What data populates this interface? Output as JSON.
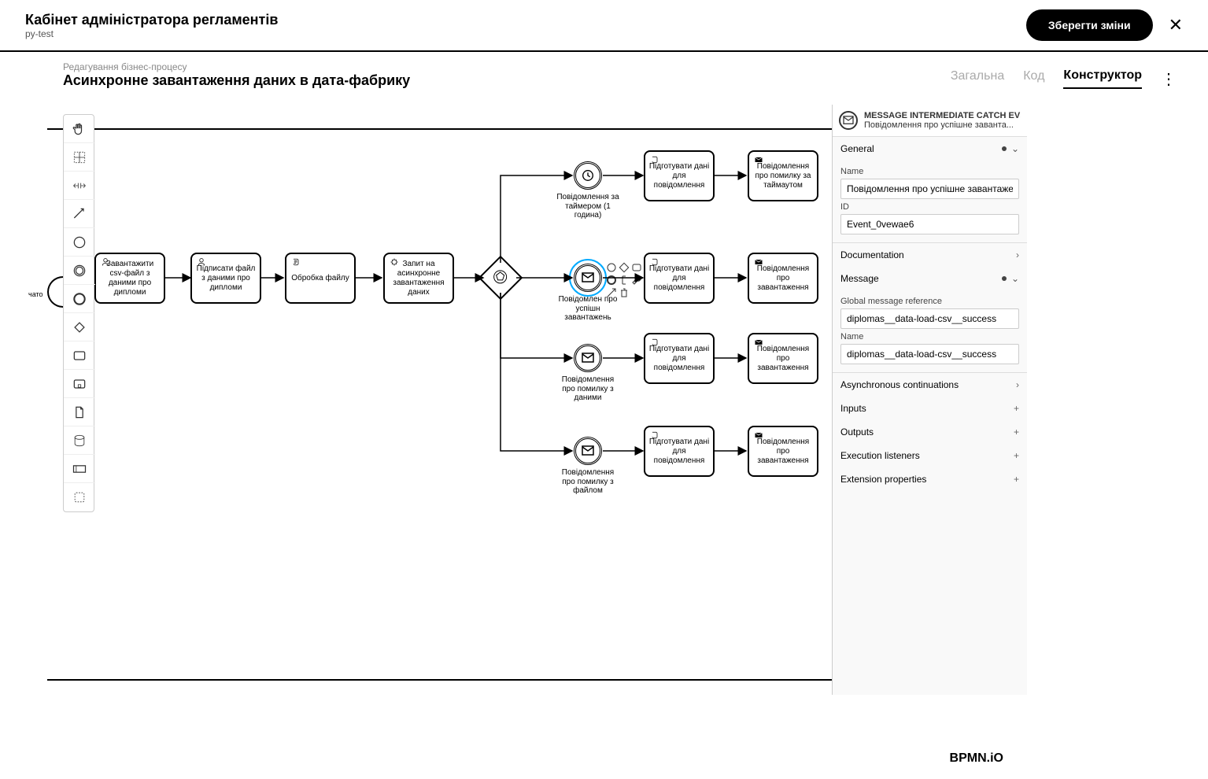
{
  "header": {
    "title": "Кабінет адміністратора регламентів",
    "subtitle": "py-test",
    "save": "Зберегти зміни"
  },
  "subheader": {
    "breadcrumb": "Редагування бізнес-процесу",
    "process_name": "Асинхронне завантаження даних в дата-фабрику",
    "tabs": {
      "general": "Загальна",
      "code": "Код",
      "constructor": "Конструктор"
    }
  },
  "pool_label_cut": "чато",
  "tasks": {
    "t1": "Завантажити csv-файл з даними про дипломи",
    "t2": "Підписати файл з даними про дипломи",
    "t3": "Обробка файлу",
    "t4": "Запит на асинхронне завантаження даних",
    "t5": "Підготувати дані для повідомлення",
    "t6": "Повідомлення про помилку за таймаутом",
    "t7": "Підготувати дані для повідомлення",
    "t8": "Повідомлення про завантаження",
    "t9": "Підготувати дані для повідомлення",
    "t10": "Повідомлення про завантаження",
    "t11": "Підготувати дані для повідомлення",
    "t12": "Повідомлення про завантаження"
  },
  "events": {
    "e1": "Повідомлення за таймером (1 година)",
    "e2": "Повідомлен про успішн завантажень",
    "e3": "Повідомлення про помилку з даними",
    "e4": "Повідомлення про помилку з файлом"
  },
  "properties": {
    "header_type": "MESSAGE INTERMEDIATE CATCH EVENT",
    "header_name": "Повідомлення про успішне заванта...",
    "sections": {
      "general": "General",
      "documentation": "Documentation",
      "message": "Message",
      "async": "Asynchronous continuations",
      "inputs": "Inputs",
      "outputs": "Outputs",
      "exec": "Execution listeners",
      "ext": "Extension properties"
    },
    "fields": {
      "name_label": "Name",
      "name_value": "Повідомлення про успішне завантажен",
      "id_label": "ID",
      "id_value": "Event_0vewae6",
      "global_ref_label": "Global message reference",
      "global_ref_value": "diplomas__data-load-csv__success",
      "msg_name_label": "Name",
      "msg_name_value": "diplomas__data-load-csv__success"
    }
  },
  "logo": "BPMN.iO"
}
